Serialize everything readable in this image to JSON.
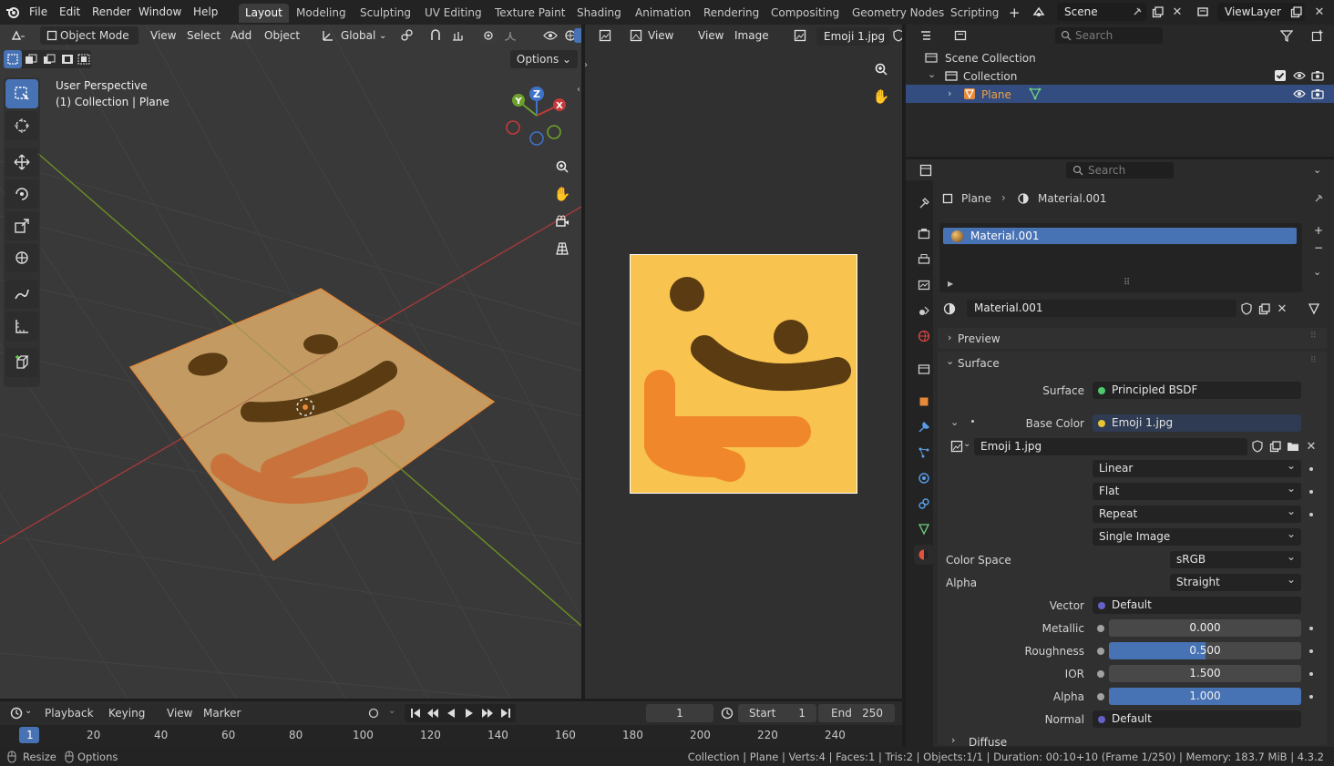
{
  "topbar": {
    "menus": [
      "File",
      "Edit",
      "Render",
      "Window",
      "Help"
    ],
    "workspaces": [
      "Layout",
      "Modeling",
      "Sculpting",
      "UV Editing",
      "Texture Paint",
      "Shading",
      "Animation",
      "Rendering",
      "Compositing",
      "Geometry Nodes",
      "Scripting"
    ],
    "active_workspace": "Layout",
    "add_tab": "+",
    "scene": "Scene",
    "view_layer": "ViewLayer"
  },
  "viewport": {
    "mode": "Object Mode",
    "menus": [
      "View",
      "Select",
      "Add",
      "Object"
    ],
    "orientation": "Global",
    "options": "Options",
    "perspective": "User Perspective",
    "collection_info": "(1) Collection | Plane",
    "gizmo": {
      "x": "X",
      "y": "Y",
      "z": "Z"
    }
  },
  "image_editor": {
    "menus": [
      "View",
      "View",
      "Image"
    ],
    "image_name": "Emoji 1.jpg"
  },
  "outliner": {
    "search_placeholder": "Search",
    "scene_collection": "Scene Collection",
    "collection": "Collection",
    "object": "Plane"
  },
  "properties": {
    "search_placeholder": "Search",
    "breadcrumb": {
      "object": "Plane",
      "material": "Material.001"
    },
    "slot": "Material.001",
    "material_name": "Material.001",
    "panels": {
      "preview": "Preview",
      "surface": "Surface",
      "diffuse": "Diffuse"
    },
    "surface": {
      "label": "Surface",
      "value": "Principled BSDF"
    },
    "base_color": {
      "label": "Base Color",
      "value": "Emoji 1.jpg"
    },
    "image_block": "Emoji 1.jpg",
    "interpolation": "Linear",
    "projection": "Flat",
    "extension": "Repeat",
    "source": "Single Image",
    "color_space": {
      "label": "Color Space",
      "value": "sRGB"
    },
    "alpha_mode": {
      "label": "Alpha",
      "value": "Straight"
    },
    "vector": {
      "label": "Vector",
      "value": "Default"
    },
    "metallic": {
      "label": "Metallic",
      "value": "0.000",
      "fraction": 0.0
    },
    "roughness": {
      "label": "Roughness",
      "value": "0.500",
      "fraction": 0.5
    },
    "ior": {
      "label": "IOR",
      "value": "1.500",
      "fraction": 0.0
    },
    "alpha": {
      "label": "Alpha",
      "value": "1.000",
      "fraction": 1.0
    },
    "normal": {
      "label": "Normal",
      "value": "Default"
    }
  },
  "timeline": {
    "menus": [
      "Playback",
      "Keying",
      "View",
      "Marker"
    ],
    "current_frame": "1",
    "start_label": "Start",
    "start": "1",
    "end_label": "End",
    "end": "250",
    "ticks": [
      "1",
      "20",
      "40",
      "60",
      "80",
      "100",
      "120",
      "140",
      "160",
      "180",
      "200",
      "220",
      "240"
    ]
  },
  "statusbar": {
    "resize": "Resize",
    "options": "Options",
    "stats": "Collection | Plane | Verts:4 | Faces:1 | Tris:2 | Objects:1/1 | Duration: 00:10+10 (Frame 1/250) | Memory: 183.7 MiB | 4.3.2"
  },
  "colors": {
    "accent": "#4772b3",
    "emoji_bg": "#f8c34e",
    "emoji_dark": "#5a3b12",
    "emoji_orange": "#f0872a"
  }
}
